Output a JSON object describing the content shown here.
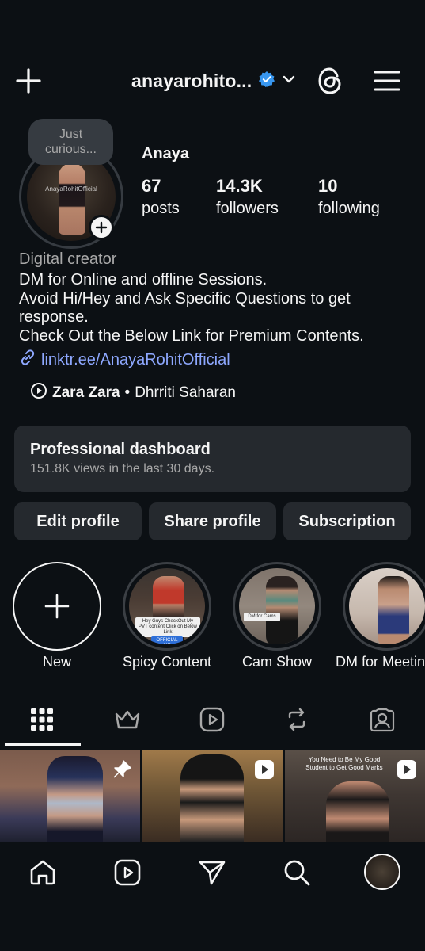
{
  "header": {
    "username": "anayarohito...",
    "verified": true
  },
  "note": {
    "text": "Just curious..."
  },
  "avatar": {
    "watermark": "AnayaRohitOfficial"
  },
  "profile": {
    "display_name": "Anaya",
    "stats": [
      {
        "value": "67",
        "label": "posts"
      },
      {
        "value": "14.3K",
        "label": "followers"
      },
      {
        "value": "10",
        "label": "following"
      }
    ],
    "category": "Digital creator",
    "bio_lines": [
      "DM for Online and offline Sessions.",
      "Avoid Hi/Hey and Ask Specific Questions to get response.",
      "Check Out the Below Link for Premium Contents."
    ],
    "link": "linktr.ee/AnayaRohitOfficial",
    "music": {
      "song": "Zara Zara",
      "separator": "•",
      "artist": "Dhrriti Saharan"
    }
  },
  "dashboard": {
    "title": "Professional dashboard",
    "subtitle": "151.8K views in the last 30 days."
  },
  "buttons": {
    "edit": "Edit profile",
    "share": "Share profile",
    "subscription": "Subscription"
  },
  "highlights": [
    {
      "label": "New"
    },
    {
      "label": "Spicy Content",
      "tag": "Hey Guys CheckOut My PVT content Click on Below Link",
      "tag2": "OFFICIAL ME"
    },
    {
      "label": "Cam Show",
      "tag": "DM for Cams"
    },
    {
      "label": "DM for Meetin"
    }
  ],
  "grid": [
    {
      "type": "pinned"
    },
    {
      "type": "reel"
    },
    {
      "type": "reel",
      "overlay": "You Need to Be My Good Student to Get Good Marks"
    }
  ],
  "colors": {
    "background": "#0c1014",
    "surface": "#25292e",
    "link": "#8ea8ff",
    "verified": "#3897f0",
    "muted": "#a8a8a8"
  }
}
